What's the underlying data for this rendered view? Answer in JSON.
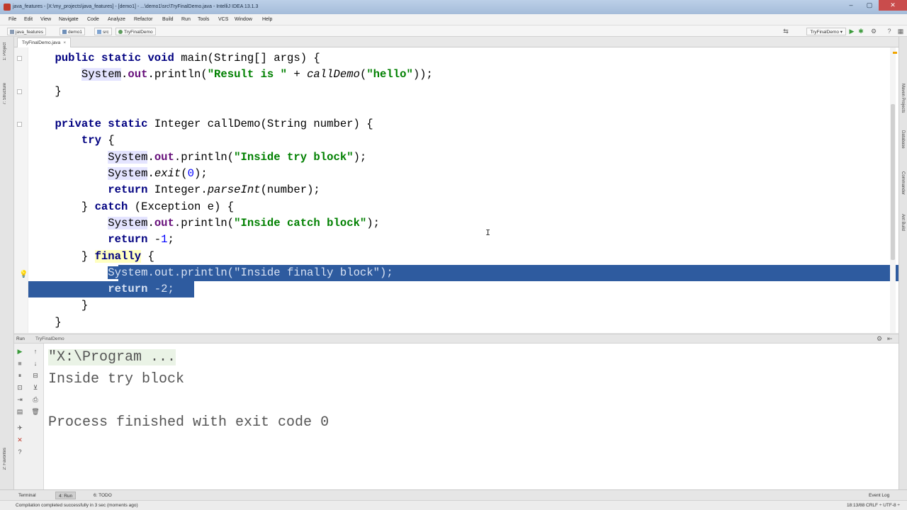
{
  "window": {
    "title": "java_features - [X:\\my_projects\\java_features] - [demo1] - ...\\demo1\\src\\TryFinalDemo.java - IntelliJ IDEA 13.1.3",
    "minimize": "–",
    "maximize": "▢",
    "close": "✕"
  },
  "menu": [
    "File",
    "Edit",
    "View",
    "Navigate",
    "Code",
    "Analyze",
    "Refactor",
    "Build",
    "Run",
    "Tools",
    "VCS",
    "Window",
    "Help"
  ],
  "breadcrumbs": [
    "java_features",
    "demo1",
    "src",
    "TryFinalDemo"
  ],
  "toolbar": {
    "run_config": "TryFinalDemo ▾"
  },
  "editor_tab": {
    "label": "TryFinalDemo.java",
    "close": "×"
  },
  "left_tool_tabs": [
    "1: Project",
    "7: Structure",
    "2: Favorites"
  ],
  "right_tool_tabs": [
    "Maven Projects",
    "Database",
    "Commander",
    "Ant Build"
  ],
  "code": {
    "l1": {
      "a": "    ",
      "kw": "public static void",
      "b": " main(String[] args) {"
    },
    "l2": {
      "a": "        ",
      "cls": "System",
      "dot": ".",
      "fld": "out",
      "b": ".println(",
      "str": "\"Result is \"",
      "c": " + ",
      "ital": "callDemo",
      "d": "(",
      "str2": "\"hello\"",
      "e": "));"
    },
    "l3": {
      "a": "    }"
    },
    "l4": {
      "a": ""
    },
    "l5": {
      "a": "    ",
      "kw": "private static",
      "b": " Integer callDemo(String number) {"
    },
    "l6": {
      "a": "        ",
      "kw": "try",
      "b": " {"
    },
    "l7": {
      "a": "            ",
      "cls": "System",
      "dot": ".",
      "fld": "out",
      "b": ".println(",
      "str": "\"Inside try block\"",
      "c": ");"
    },
    "l8": {
      "a": "            ",
      "cls": "System",
      "b": ".",
      "ital": "exit",
      "c": "(",
      "num": "0",
      "d": ");"
    },
    "l9": {
      "a": "            ",
      "kw": "return",
      "b": " Integer.",
      "ital": "parseInt",
      "c": "(number);"
    },
    "l10": {
      "a": "        } ",
      "kw": "catch",
      "b": " (Exception e) {"
    },
    "l11": {
      "a": "            ",
      "cls": "System",
      "dot": ".",
      "fld": "out",
      "b": ".println(",
      "str": "\"Inside catch block\"",
      "c": ");"
    },
    "l12": {
      "a": "            ",
      "kw": "return",
      "b": " -",
      "num": "1",
      "c": ";"
    },
    "l13": {
      "a": "        } ",
      "kw": "finally",
      "b": " {"
    },
    "l14": {
      "a": "            ",
      "cls": "System",
      "dot": ".",
      "fld": "out",
      "b": ".println(",
      "str": "\"Inside finally block\"",
      "c": ");"
    },
    "l15": {
      "a": "            ",
      "kw": "return",
      "b": " -",
      "num": "2",
      "c": ";"
    },
    "l16": {
      "a": "        }"
    },
    "l17": {
      "a": "    }"
    }
  },
  "run_panel": {
    "label": "Run",
    "config": "TryFinalDemo",
    "settings": "⚙",
    "hide": "⇤"
  },
  "console": {
    "line1": "\"X:\\Program ...",
    "line2": "Inside try block",
    "line3": "Process finished with exit code 0"
  },
  "bottom_tabs": [
    "Terminal",
    "4: Run",
    "6: TODO"
  ],
  "event_log": "Event Log",
  "status": {
    "message": "Compilation completed successfully in 3 sec (moments ago)",
    "right": "18:13/88   CRLF ÷   UTF-8 ÷"
  }
}
